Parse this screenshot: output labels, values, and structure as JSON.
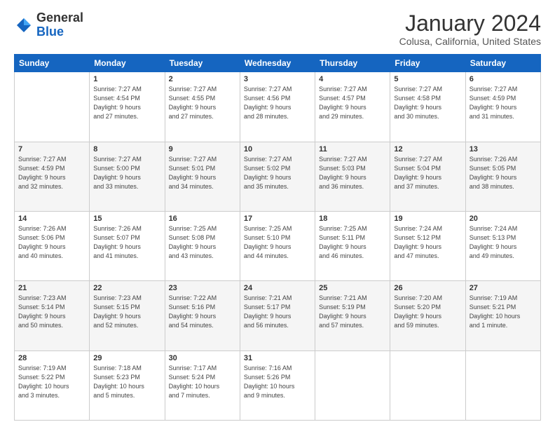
{
  "logo": {
    "general": "General",
    "blue": "Blue"
  },
  "header": {
    "title": "January 2024",
    "location": "Colusa, California, United States"
  },
  "weekdays": [
    "Sunday",
    "Monday",
    "Tuesday",
    "Wednesday",
    "Thursday",
    "Friday",
    "Saturday"
  ],
  "weeks": [
    [
      {
        "day": "",
        "info": ""
      },
      {
        "day": "1",
        "info": "Sunrise: 7:27 AM\nSunset: 4:54 PM\nDaylight: 9 hours\nand 27 minutes."
      },
      {
        "day": "2",
        "info": "Sunrise: 7:27 AM\nSunset: 4:55 PM\nDaylight: 9 hours\nand 27 minutes."
      },
      {
        "day": "3",
        "info": "Sunrise: 7:27 AM\nSunset: 4:56 PM\nDaylight: 9 hours\nand 28 minutes."
      },
      {
        "day": "4",
        "info": "Sunrise: 7:27 AM\nSunset: 4:57 PM\nDaylight: 9 hours\nand 29 minutes."
      },
      {
        "day": "5",
        "info": "Sunrise: 7:27 AM\nSunset: 4:58 PM\nDaylight: 9 hours\nand 30 minutes."
      },
      {
        "day": "6",
        "info": "Sunrise: 7:27 AM\nSunset: 4:59 PM\nDaylight: 9 hours\nand 31 minutes."
      }
    ],
    [
      {
        "day": "7",
        "info": "Sunrise: 7:27 AM\nSunset: 4:59 PM\nDaylight: 9 hours\nand 32 minutes."
      },
      {
        "day": "8",
        "info": "Sunrise: 7:27 AM\nSunset: 5:00 PM\nDaylight: 9 hours\nand 33 minutes."
      },
      {
        "day": "9",
        "info": "Sunrise: 7:27 AM\nSunset: 5:01 PM\nDaylight: 9 hours\nand 34 minutes."
      },
      {
        "day": "10",
        "info": "Sunrise: 7:27 AM\nSunset: 5:02 PM\nDaylight: 9 hours\nand 35 minutes."
      },
      {
        "day": "11",
        "info": "Sunrise: 7:27 AM\nSunset: 5:03 PM\nDaylight: 9 hours\nand 36 minutes."
      },
      {
        "day": "12",
        "info": "Sunrise: 7:27 AM\nSunset: 5:04 PM\nDaylight: 9 hours\nand 37 minutes."
      },
      {
        "day": "13",
        "info": "Sunrise: 7:26 AM\nSunset: 5:05 PM\nDaylight: 9 hours\nand 38 minutes."
      }
    ],
    [
      {
        "day": "14",
        "info": "Sunrise: 7:26 AM\nSunset: 5:06 PM\nDaylight: 9 hours\nand 40 minutes."
      },
      {
        "day": "15",
        "info": "Sunrise: 7:26 AM\nSunset: 5:07 PM\nDaylight: 9 hours\nand 41 minutes."
      },
      {
        "day": "16",
        "info": "Sunrise: 7:25 AM\nSunset: 5:08 PM\nDaylight: 9 hours\nand 43 minutes."
      },
      {
        "day": "17",
        "info": "Sunrise: 7:25 AM\nSunset: 5:10 PM\nDaylight: 9 hours\nand 44 minutes."
      },
      {
        "day": "18",
        "info": "Sunrise: 7:25 AM\nSunset: 5:11 PM\nDaylight: 9 hours\nand 46 minutes."
      },
      {
        "day": "19",
        "info": "Sunrise: 7:24 AM\nSunset: 5:12 PM\nDaylight: 9 hours\nand 47 minutes."
      },
      {
        "day": "20",
        "info": "Sunrise: 7:24 AM\nSunset: 5:13 PM\nDaylight: 9 hours\nand 49 minutes."
      }
    ],
    [
      {
        "day": "21",
        "info": "Sunrise: 7:23 AM\nSunset: 5:14 PM\nDaylight: 9 hours\nand 50 minutes."
      },
      {
        "day": "22",
        "info": "Sunrise: 7:23 AM\nSunset: 5:15 PM\nDaylight: 9 hours\nand 52 minutes."
      },
      {
        "day": "23",
        "info": "Sunrise: 7:22 AM\nSunset: 5:16 PM\nDaylight: 9 hours\nand 54 minutes."
      },
      {
        "day": "24",
        "info": "Sunrise: 7:21 AM\nSunset: 5:17 PM\nDaylight: 9 hours\nand 56 minutes."
      },
      {
        "day": "25",
        "info": "Sunrise: 7:21 AM\nSunset: 5:19 PM\nDaylight: 9 hours\nand 57 minutes."
      },
      {
        "day": "26",
        "info": "Sunrise: 7:20 AM\nSunset: 5:20 PM\nDaylight: 9 hours\nand 59 minutes."
      },
      {
        "day": "27",
        "info": "Sunrise: 7:19 AM\nSunset: 5:21 PM\nDaylight: 10 hours\nand 1 minute."
      }
    ],
    [
      {
        "day": "28",
        "info": "Sunrise: 7:19 AM\nSunset: 5:22 PM\nDaylight: 10 hours\nand 3 minutes."
      },
      {
        "day": "29",
        "info": "Sunrise: 7:18 AM\nSunset: 5:23 PM\nDaylight: 10 hours\nand 5 minutes."
      },
      {
        "day": "30",
        "info": "Sunrise: 7:17 AM\nSunset: 5:24 PM\nDaylight: 10 hours\nand 7 minutes."
      },
      {
        "day": "31",
        "info": "Sunrise: 7:16 AM\nSunset: 5:26 PM\nDaylight: 10 hours\nand 9 minutes."
      },
      {
        "day": "",
        "info": ""
      },
      {
        "day": "",
        "info": ""
      },
      {
        "day": "",
        "info": ""
      }
    ]
  ]
}
